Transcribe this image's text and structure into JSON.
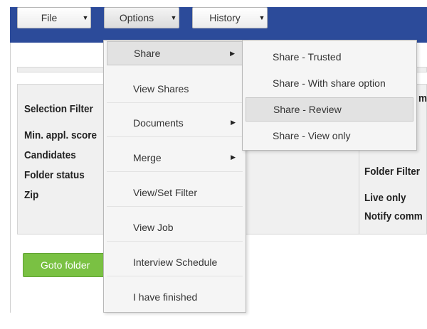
{
  "menubar": {
    "file": "File",
    "options": "Options",
    "history": "History"
  },
  "options_menu": {
    "items": [
      {
        "label": "Share",
        "submenu": true
      },
      {
        "label": "View Shares",
        "submenu": false
      },
      {
        "label": "Documents",
        "submenu": true
      },
      {
        "label": "Merge",
        "submenu": true
      },
      {
        "label": "View/Set Filter",
        "submenu": false
      },
      {
        "label": "View Job",
        "submenu": false
      },
      {
        "label": "Interview Schedule",
        "submenu": false
      },
      {
        "label": "I have finished",
        "submenu": false
      }
    ]
  },
  "share_submenu": {
    "items": [
      {
        "label": "Share - Trusted"
      },
      {
        "label": "Share - With share option"
      },
      {
        "label": "Share - Review"
      },
      {
        "label": "Share - View only"
      }
    ]
  },
  "filters": {
    "left": {
      "title": "Selection Filter",
      "rows": [
        "Min. appl. score",
        "Candidates",
        "Folder status",
        "Zip"
      ]
    },
    "right": {
      "top_fragment": "m",
      "title": "Folder Filter",
      "rows": [
        "Live only",
        "Notify comm"
      ]
    }
  },
  "actions": {
    "goto": "Goto folder"
  }
}
